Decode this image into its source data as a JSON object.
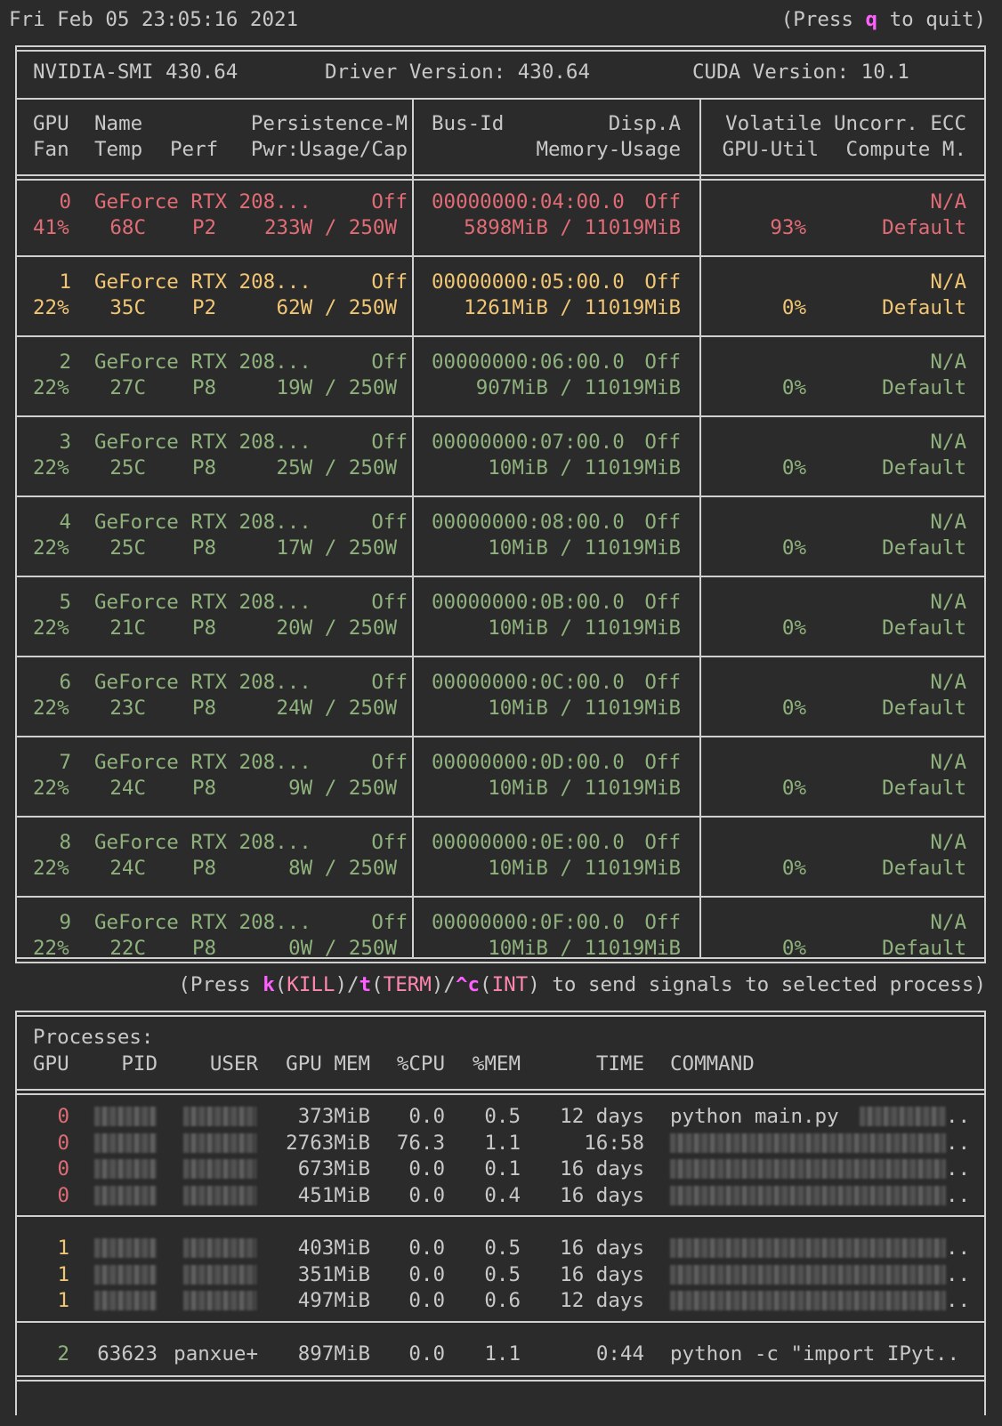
{
  "header": {
    "datetime": "Fri Feb 05 23:05:16 2021",
    "quit_pre": "(Press ",
    "quit_key": "q",
    "quit_post": " to quit)"
  },
  "summary": {
    "smi": "NVIDIA-SMI 430.64",
    "driver": "Driver Version: 430.64",
    "cuda": "CUDA Version: 10.1"
  },
  "columns": {
    "row1": {
      "gpu": "GPU",
      "name": "Name",
      "persistence": "Persistence-M",
      "bus": "Bus-Id",
      "disp": "Disp.A",
      "volatile": "Volatile Uncorr. ECC"
    },
    "row2": {
      "fan": "Fan",
      "temp": "Temp",
      "perf": "Perf",
      "pwr": "Pwr:Usage/Cap",
      "memory": "Memory-Usage",
      "util": "GPU-Util",
      "compute": "Compute M."
    }
  },
  "gpus": [
    {
      "id": "0",
      "name": "GeForce RTX 208...",
      "persistence": "Off",
      "bus": "00000000:04:00.0",
      "disp": "Off",
      "ecc": "N/A",
      "fan": "41%",
      "temp": "68C",
      "perf": "P2",
      "pwr": "233W / 250W",
      "mem": "5898MiB / 11019MiB",
      "util": "93%",
      "compute": "Default",
      "color": "#e06c75"
    },
    {
      "id": "1",
      "name": "GeForce RTX 208...",
      "persistence": "Off",
      "bus": "00000000:05:00.0",
      "disp": "Off",
      "ecc": "N/A",
      "fan": "22%",
      "temp": "35C",
      "perf": "P2",
      "pwr": "62W / 250W",
      "mem": "1261MiB / 11019MiB",
      "util": "0%",
      "compute": "Default",
      "color": "#f0c674"
    },
    {
      "id": "2",
      "name": "GeForce RTX 208...",
      "persistence": "Off",
      "bus": "00000000:06:00.0",
      "disp": "Off",
      "ecc": "N/A",
      "fan": "22%",
      "temp": "27C",
      "perf": "P8",
      "pwr": "19W / 250W",
      "mem": "907MiB / 11019MiB",
      "util": "0%",
      "compute": "Default",
      "color": "#8fb27d"
    },
    {
      "id": "3",
      "name": "GeForce RTX 208...",
      "persistence": "Off",
      "bus": "00000000:07:00.0",
      "disp": "Off",
      "ecc": "N/A",
      "fan": "22%",
      "temp": "25C",
      "perf": "P8",
      "pwr": "25W / 250W",
      "mem": "10MiB / 11019MiB",
      "util": "0%",
      "compute": "Default",
      "color": "#8fb27d"
    },
    {
      "id": "4",
      "name": "GeForce RTX 208...",
      "persistence": "Off",
      "bus": "00000000:08:00.0",
      "disp": "Off",
      "ecc": "N/A",
      "fan": "22%",
      "temp": "25C",
      "perf": "P8",
      "pwr": "17W / 250W",
      "mem": "10MiB / 11019MiB",
      "util": "0%",
      "compute": "Default",
      "color": "#8fb27d"
    },
    {
      "id": "5",
      "name": "GeForce RTX 208...",
      "persistence": "Off",
      "bus": "00000000:0B:00.0",
      "disp": "Off",
      "ecc": "N/A",
      "fan": "22%",
      "temp": "21C",
      "perf": "P8",
      "pwr": "20W / 250W",
      "mem": "10MiB / 11019MiB",
      "util": "0%",
      "compute": "Default",
      "color": "#8fb27d"
    },
    {
      "id": "6",
      "name": "GeForce RTX 208...",
      "persistence": "Off",
      "bus": "00000000:0C:00.0",
      "disp": "Off",
      "ecc": "N/A",
      "fan": "22%",
      "temp": "23C",
      "perf": "P8",
      "pwr": "24W / 250W",
      "mem": "10MiB / 11019MiB",
      "util": "0%",
      "compute": "Default",
      "color": "#8fb27d"
    },
    {
      "id": "7",
      "name": "GeForce RTX 208...",
      "persistence": "Off",
      "bus": "00000000:0D:00.0",
      "disp": "Off",
      "ecc": "N/A",
      "fan": "22%",
      "temp": "24C",
      "perf": "P8",
      "pwr": "9W / 250W",
      "mem": "10MiB / 11019MiB",
      "util": "0%",
      "compute": "Default",
      "color": "#8fb27d"
    },
    {
      "id": "8",
      "name": "GeForce RTX 208...",
      "persistence": "Off",
      "bus": "00000000:0E:00.0",
      "disp": "Off",
      "ecc": "N/A",
      "fan": "22%",
      "temp": "24C",
      "perf": "P8",
      "pwr": "8W / 250W",
      "mem": "10MiB / 11019MiB",
      "util": "0%",
      "compute": "Default",
      "color": "#8fb27d"
    },
    {
      "id": "9",
      "name": "GeForce RTX 208...",
      "persistence": "Off",
      "bus": "00000000:0F:00.0",
      "disp": "Off",
      "ecc": "N/A",
      "fan": "22%",
      "temp": "22C",
      "perf": "P8",
      "pwr": "0W / 250W",
      "mem": "10MiB / 11019MiB",
      "util": "0%",
      "compute": "Default",
      "color": "#8fb27d"
    }
  ],
  "signals": {
    "pre": "(Press ",
    "k": "k",
    "kill": "KILL",
    "t": "t",
    "term": "TERM",
    "c": "^c",
    "int": "INT",
    "post": " to send signals to selected process)"
  },
  "processes": {
    "title": "Processes:",
    "headers": {
      "gpu": "GPU",
      "pid": "PID",
      "user": "USER",
      "gpumem": "GPU MEM",
      "cpu": "%CPU",
      "mem": "%MEM",
      "time": "TIME",
      "command": "COMMAND"
    },
    "groups": [
      {
        "color": "#e06c75",
        "rows": [
          {
            "gpu": "0",
            "pid": "",
            "user": "",
            "gpumem": "373MiB",
            "cpu": "0.0",
            "mem": "0.5",
            "time": "12 days",
            "command": "python main.py",
            "blurred_cmd": false
          },
          {
            "gpu": "0",
            "pid": "",
            "user": "",
            "gpumem": "2763MiB",
            "cpu": "76.3",
            "mem": "1.1",
            "time": "16:58",
            "command": "",
            "blurred_cmd": true
          },
          {
            "gpu": "0",
            "pid": "",
            "user": "",
            "gpumem": "673MiB",
            "cpu": "0.0",
            "mem": "0.1",
            "time": "16 days",
            "command": "",
            "blurred_cmd": true
          },
          {
            "gpu": "0",
            "pid": "",
            "user": "",
            "gpumem": "451MiB",
            "cpu": "0.0",
            "mem": "0.4",
            "time": "16 days",
            "command": "",
            "blurred_cmd": true
          }
        ]
      },
      {
        "color": "#f0c674",
        "rows": [
          {
            "gpu": "1",
            "pid": "",
            "user": "",
            "gpumem": "403MiB",
            "cpu": "0.0",
            "mem": "0.5",
            "time": "16 days",
            "command": "",
            "blurred_cmd": true
          },
          {
            "gpu": "1",
            "pid": "",
            "user": "",
            "gpumem": "351MiB",
            "cpu": "0.0",
            "mem": "0.5",
            "time": "16 days",
            "command": "",
            "blurred_cmd": true
          },
          {
            "gpu": "1",
            "pid": "",
            "user": "",
            "gpumem": "497MiB",
            "cpu": "0.0",
            "mem": "0.6",
            "time": "12 days",
            "command": "",
            "blurred_cmd": true
          }
        ]
      },
      {
        "color": "#8fb27d",
        "rows": [
          {
            "gpu": "2",
            "pid": "63623",
            "user": "panxue+",
            "gpumem": "897MiB",
            "cpu": "0.0",
            "mem": "1.1",
            "time": "0:44",
            "command": "python -c \"import IPyt..",
            "blurred_cmd": false
          }
        ]
      }
    ]
  }
}
